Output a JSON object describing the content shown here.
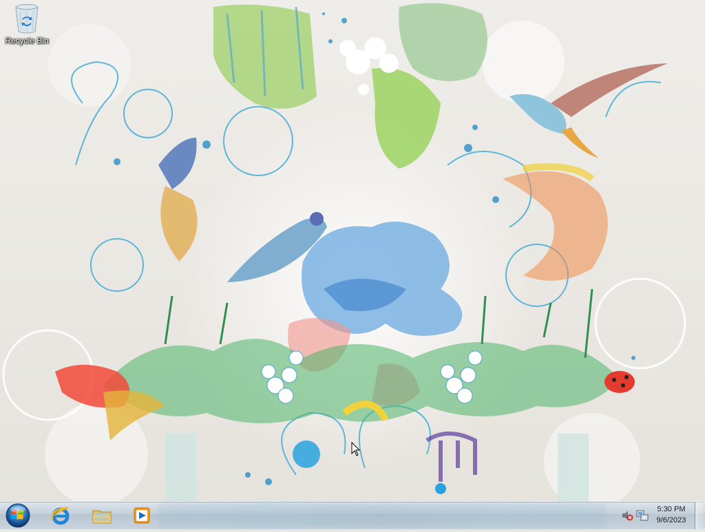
{
  "desktop": {
    "icons": [
      {
        "label": "Recycle Bin",
        "icon": "recycle-bin-icon"
      }
    ]
  },
  "taskbar": {
    "start_icon": "windows-start-orb-icon",
    "pinned": [
      {
        "icon": "internet-explorer-icon"
      },
      {
        "icon": "file-explorer-icon"
      },
      {
        "icon": "media-player-icon"
      }
    ],
    "tray": {
      "volume_icon": "volume-muted-icon",
      "network_icon": "network-icon"
    },
    "clock": {
      "time": "5:30 PM",
      "date": "9/6/2023"
    }
  },
  "colors": {
    "taskbar": "#c3cfd9",
    "wallpaper_bg": "#ebe9e4",
    "accent_blue": "#3aa0d8",
    "accent_green": "#6cbf3a"
  }
}
